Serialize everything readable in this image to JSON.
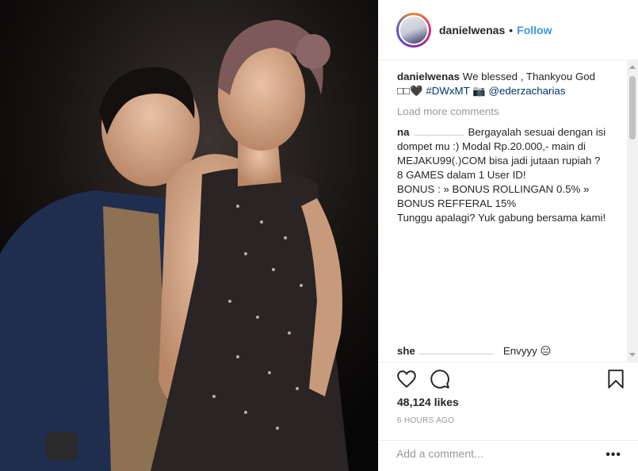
{
  "post": {
    "username": "danielwenas",
    "separator": "•",
    "follow_label": "Follow"
  },
  "caption": {
    "username": "danielwenas",
    "text": "We blessed , Thankyou God",
    "line2_prefix": "□□🖤",
    "hashtag": "#DWxMT",
    "camera": "📷",
    "mention": "@ederzacharias"
  },
  "load_more_label": "Load more comments",
  "comments": [
    {
      "username": "na",
      "text": "Bergayalah sesuai dengan isi dompet mu :) Modal Rp.20.000,- main di MEJAKU99(.)COM bisa jadi jutaan rupiah ?\n8 GAMES dalam 1 User ID!\nBONUS : » BONUS ROLLINGAN 0.5% » BONUS REFFERAL 15%\nTunggu apalagi? Yuk gabung bersama kami!"
    },
    {
      "username": "she",
      "text": "Envyyy 😐"
    }
  ],
  "actions": {
    "likes": "48,124 likes",
    "timestamp": "6 HOURS AGO"
  },
  "add_comment": {
    "placeholder": "Add a comment...",
    "more_label": "•••"
  }
}
